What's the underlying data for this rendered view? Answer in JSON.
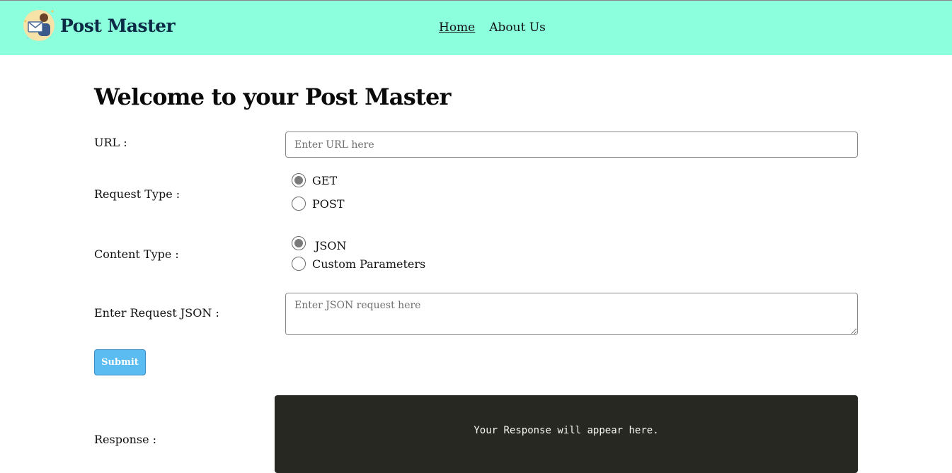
{
  "brand": {
    "name": "Post Master",
    "logo_icon": "mail-person-icon"
  },
  "nav": {
    "home_label": "Home",
    "about_label": "About Us"
  },
  "page_title": "Welcome to your Post Master",
  "url_field": {
    "label": "URL :",
    "placeholder": "Enter URL here",
    "value": ""
  },
  "request_type": {
    "label": "Request Type :",
    "options": [
      {
        "label": "GET",
        "checked": true
      },
      {
        "label": "POST",
        "checked": false
      }
    ]
  },
  "content_type": {
    "label": "Content Type :",
    "options": [
      {
        "label": "JSON",
        "checked": true
      },
      {
        "label": "Custom Parameters",
        "checked": false
      }
    ]
  },
  "request_json": {
    "label": "Enter Request JSON :",
    "placeholder": "Enter JSON request here",
    "value": ""
  },
  "submit_label": "Submit",
  "response": {
    "label": "Response :",
    "placeholder_text": "Your Response will appear here."
  },
  "colors": {
    "navbar_bg": "#8cffdc",
    "brand_text": "#0c2a45",
    "submit_bg": "#5bbcf2",
    "response_bg": "#272822"
  }
}
